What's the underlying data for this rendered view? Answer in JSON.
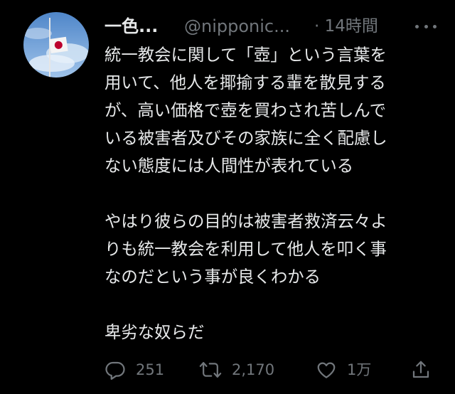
{
  "tweet": {
    "display_name": "一色...",
    "handle": "@nipponic...",
    "time": "· 14時間",
    "lines": [
      "統一教会に関して「壺」という言葉を",
      "用いて、他人を揶揄する輩を散見する",
      "が、高い価格で壺を買わされ苦しんで",
      "いる被害者及びその家族に全く配慮し",
      "ない態度には人間性が表れている",
      "",
      "やはり彼らの目的は被害者救済云々よ",
      "りも統一教会を利用して他人を叩く事",
      "なのだという事が良くわかる",
      "",
      "卑劣な奴らだ"
    ],
    "actions": {
      "reply_count": "251",
      "retweet_count": "2,170",
      "like_count": "1万"
    }
  },
  "icons": {
    "more": "more-horizontal-icon",
    "reply": "reply-icon",
    "retweet": "retweet-icon",
    "like": "heart-icon",
    "share": "share-icon"
  },
  "colors": {
    "background": "#000000",
    "text": "#e7e9ea",
    "secondary": "#71767b",
    "flag_red": "#bc002d"
  }
}
